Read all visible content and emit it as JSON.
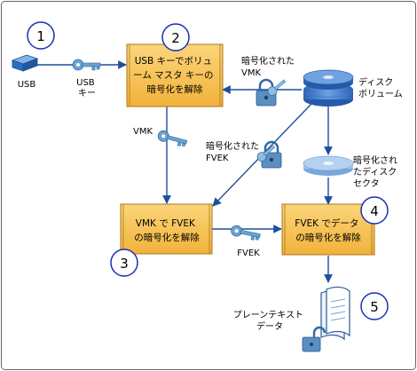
{
  "steps": {
    "s1": "1",
    "s2": "2",
    "s3": "3",
    "s4": "4",
    "s5": "5"
  },
  "nodes": {
    "usb_device": "USB",
    "usb_key": [
      "USB",
      "キー"
    ],
    "box_usb": [
      "USB キーでボリュ",
      "ーム マスタ キーの",
      "暗号化を解除"
    ],
    "enc_vmk": [
      "暗号化された",
      "VMK"
    ],
    "disk_volume": [
      "ディスク",
      "ボリューム"
    ],
    "vmk": "VMK",
    "enc_fvek": [
      "暗号化された",
      "FVEK"
    ],
    "enc_sector": [
      "暗号化され",
      "たディスク",
      "セクタ"
    ],
    "box_vmk": [
      "VMK で FVEK",
      "の暗号化を解除"
    ],
    "fvek": "FVEK",
    "box_fvek": [
      "FVEK でデータ",
      "の暗号化を解除"
    ],
    "plaintext": [
      "プレーンテキスト",
      "データ"
    ]
  },
  "colors": {
    "box_fill": "#f9c248",
    "box_border": "#a8761b",
    "arrow": "#1f4e9a",
    "circle": "#1b2fb5",
    "device": "#2a6fbf",
    "key": "#6aa3cf",
    "lock": "#5b8fc2",
    "disk": "#3c78c5",
    "frame": "#666666"
  }
}
